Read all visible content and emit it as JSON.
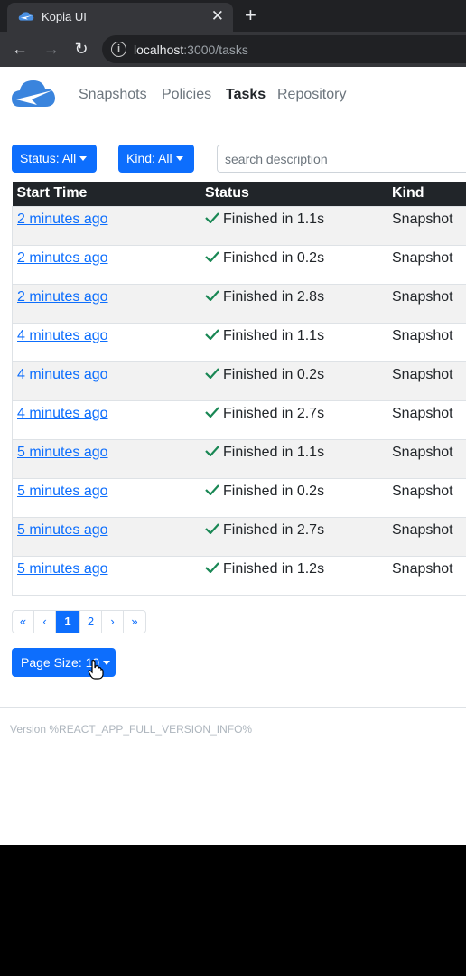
{
  "browser": {
    "tab_title": "Kopia UI",
    "tab_close": "✕",
    "new_tab": "+",
    "back": "←",
    "forward": "→",
    "reload": "↻",
    "info": "i",
    "url_host": "localhost",
    "url_rest": ":3000/tasks"
  },
  "nav": {
    "links": [
      "Snapshots",
      "Policies",
      "Tasks",
      "Repository"
    ],
    "active": "Tasks"
  },
  "filters": {
    "status_label": "Status: All",
    "kind_label": "Kind: All",
    "search_placeholder": "search description"
  },
  "table": {
    "headers": [
      "Start Time",
      "Status",
      "Kind"
    ],
    "rows": [
      {
        "start": "2 minutes ago",
        "status": "Finished in 1.1s",
        "kind": "Snapshot"
      },
      {
        "start": "2 minutes ago",
        "status": "Finished in 0.2s",
        "kind": "Snapshot"
      },
      {
        "start": "2 minutes ago",
        "status": "Finished in 2.8s",
        "kind": "Snapshot"
      },
      {
        "start": "4 minutes ago",
        "status": "Finished in 1.1s",
        "kind": "Snapshot"
      },
      {
        "start": "4 minutes ago",
        "status": "Finished in 0.2s",
        "kind": "Snapshot"
      },
      {
        "start": "4 minutes ago",
        "status": "Finished in 2.7s",
        "kind": "Snapshot"
      },
      {
        "start": "5 minutes ago",
        "status": "Finished in 1.1s",
        "kind": "Snapshot"
      },
      {
        "start": "5 minutes ago",
        "status": "Finished in 0.2s",
        "kind": "Snapshot"
      },
      {
        "start": "5 minutes ago",
        "status": "Finished in 2.7s",
        "kind": "Snapshot"
      },
      {
        "start": "5 minutes ago",
        "status": "Finished in 1.2s",
        "kind": "Snapshot"
      }
    ]
  },
  "pagination": {
    "first": "«",
    "prev": "‹",
    "pages": [
      "1",
      "2"
    ],
    "current": "1",
    "next": "›",
    "last": "»"
  },
  "page_size": {
    "label": "Page Size: 10"
  },
  "footer": {
    "version": "Version %REACT_APP_FULL_VERSION_INFO%"
  },
  "colors": {
    "primary": "#0d6efd",
    "success_check": "#198754",
    "header_dark": "#212529"
  }
}
